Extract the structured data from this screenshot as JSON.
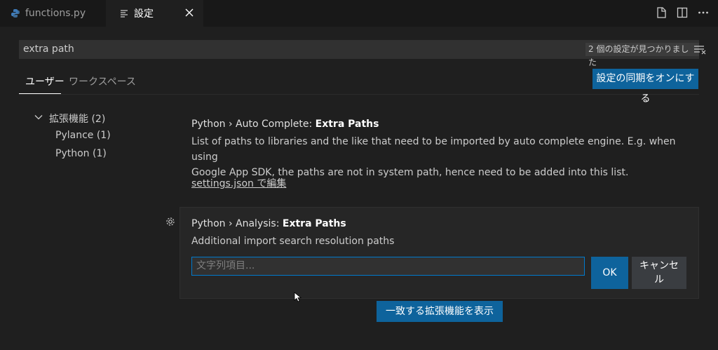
{
  "tabs": [
    {
      "label": "functions.py",
      "icon": "python-file-icon",
      "active": false
    },
    {
      "label": "設定",
      "icon": "settings-list-icon",
      "active": true
    }
  ],
  "editor_actions": [
    "open-settings-json-icon",
    "split-editor-icon",
    "more-actions-icon"
  ],
  "search": {
    "value": "extra path",
    "result_count": "2 個の設定が見つかりました"
  },
  "scope_tabs": {
    "user": "ユーザー",
    "workspace": "ワークスペース"
  },
  "sync_button": "設定の同期をオンにする",
  "toc": {
    "group": "拡張機能 (2)",
    "items": [
      "Pylance (1)",
      "Python (1)"
    ]
  },
  "settings": [
    {
      "category": "Python › Auto Complete: ",
      "name": "Extra Paths",
      "description_line1": "List of paths to libraries and the like that need to be imported by auto complete engine. E.g. when using",
      "description_line2": "Google App SDK, the paths are not in system path, hence need to be added into this list.",
      "link": "settings.json で編集"
    },
    {
      "category": "Python › Analysis: ",
      "name": "Extra Paths",
      "description": "Additional import search resolution paths",
      "input_placeholder": "文字列項目...",
      "ok": "OK",
      "cancel_line1": "キャンセ",
      "cancel_line2": "ル"
    }
  ],
  "extension_button": "一致する拡張機能を表示",
  "colors": {
    "accent": "#0e639c",
    "focus_border": "#007acc",
    "background": "#1f1f1f"
  }
}
